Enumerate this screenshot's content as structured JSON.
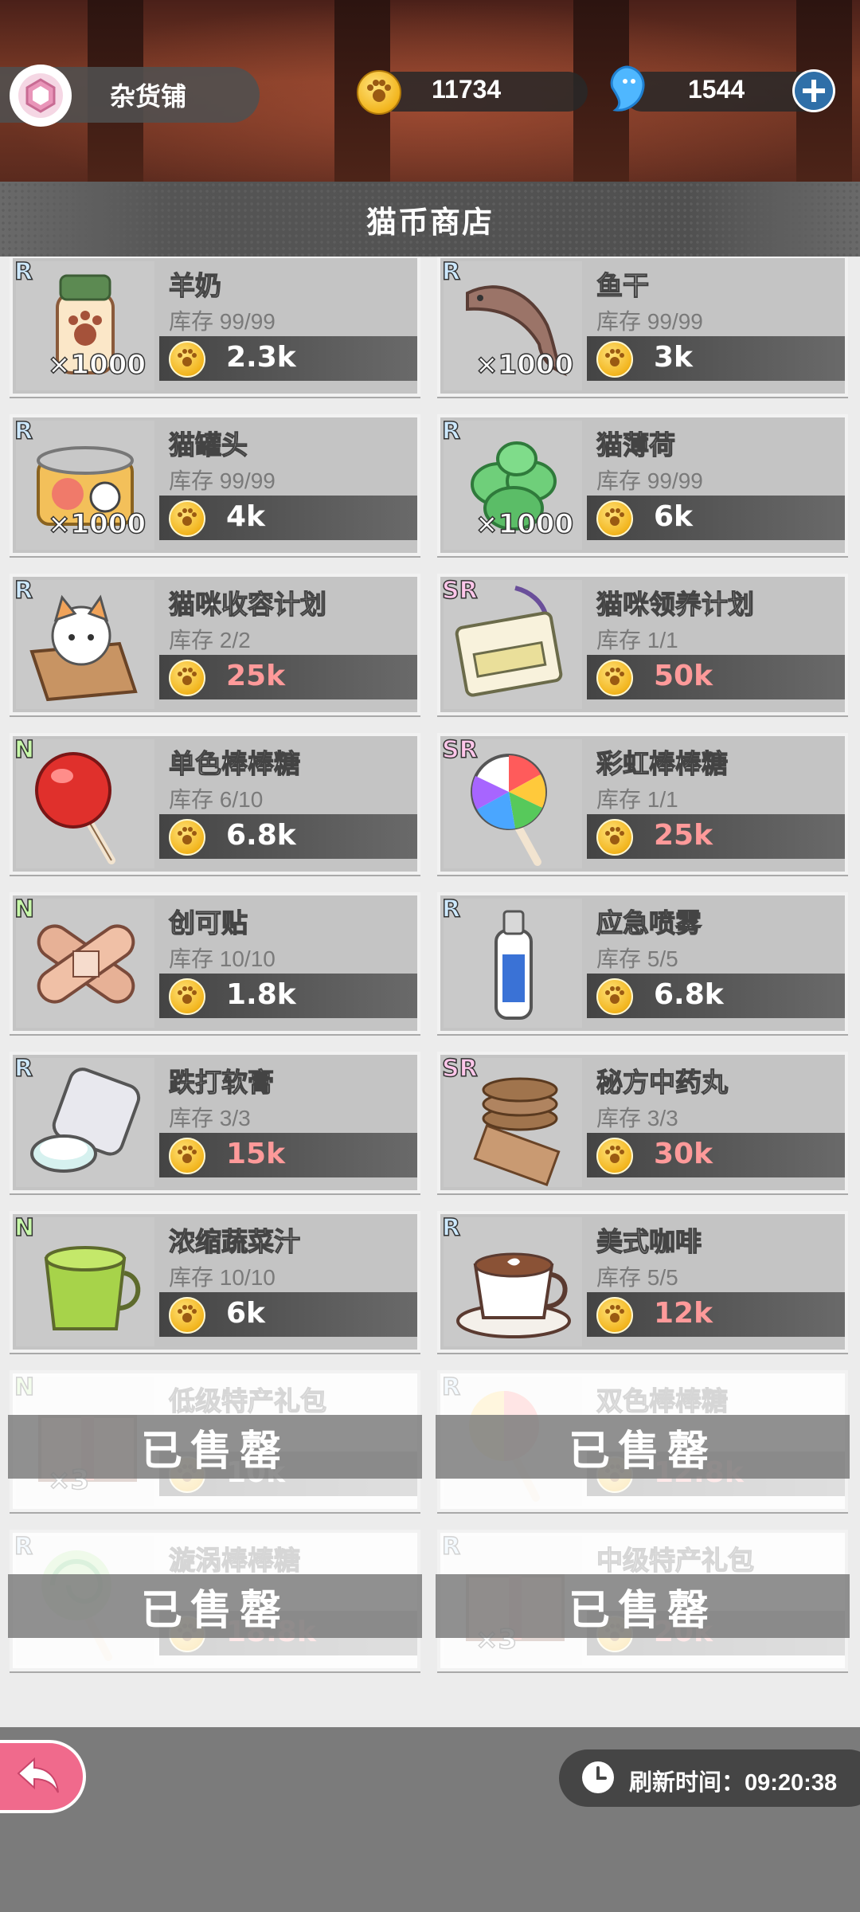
{
  "header": {
    "shop_name": "杂货铺",
    "coins": "11734",
    "gems": "1544"
  },
  "title": "猫币商店",
  "items": [
    {
      "name": "羊奶",
      "rarity": "R",
      "stock": "库存 99/99",
      "price": "2.3k",
      "qty": "×1000",
      "expensive": false,
      "sold_out": false,
      "icon": "goat-milk-icon"
    },
    {
      "name": "鱼干",
      "rarity": "R",
      "stock": "库存 99/99",
      "price": "3k",
      "qty": "×1000",
      "expensive": false,
      "sold_out": false,
      "icon": "dried-fish-icon"
    },
    {
      "name": "猫罐头",
      "rarity": "R",
      "stock": "库存 99/99",
      "price": "4k",
      "qty": "×1000",
      "expensive": false,
      "sold_out": false,
      "icon": "cat-can-icon"
    },
    {
      "name": "猫薄荷",
      "rarity": "R",
      "stock": "库存 99/99",
      "price": "6k",
      "qty": "×1000",
      "expensive": false,
      "sold_out": false,
      "icon": "catnip-icon"
    },
    {
      "name": "猫咪收容计划",
      "rarity": "R",
      "stock": "库存 2/2",
      "price": "25k",
      "qty": "",
      "expensive": true,
      "sold_out": false,
      "icon": "cat-box-icon"
    },
    {
      "name": "猫咪领养计划",
      "rarity": "SR",
      "stock": "库存 1/1",
      "price": "50k",
      "qty": "",
      "expensive": true,
      "sold_out": false,
      "icon": "adoption-card-icon"
    },
    {
      "name": "单色棒棒糖",
      "rarity": "N",
      "stock": "库存 6/10",
      "price": "6.8k",
      "qty": "",
      "expensive": false,
      "sold_out": false,
      "icon": "red-lollipop-icon"
    },
    {
      "name": "彩虹棒棒糖",
      "rarity": "SR",
      "stock": "库存 1/1",
      "price": "25k",
      "qty": "",
      "expensive": true,
      "sold_out": false,
      "icon": "rainbow-lollipop-icon"
    },
    {
      "name": "创可贴",
      "rarity": "N",
      "stock": "库存 10/10",
      "price": "1.8k",
      "qty": "",
      "expensive": false,
      "sold_out": false,
      "icon": "bandage-icon"
    },
    {
      "name": "应急喷雾",
      "rarity": "R",
      "stock": "库存 5/5",
      "price": "6.8k",
      "qty": "",
      "expensive": false,
      "sold_out": false,
      "icon": "spray-bottle-icon"
    },
    {
      "name": "跌打软膏",
      "rarity": "R",
      "stock": "库存 3/3",
      "price": "15k",
      "qty": "",
      "expensive": true,
      "sold_out": false,
      "icon": "ointment-icon"
    },
    {
      "name": "秘方中药丸",
      "rarity": "SR",
      "stock": "库存 3/3",
      "price": "30k",
      "qty": "",
      "expensive": true,
      "sold_out": false,
      "icon": "herbal-pills-icon"
    },
    {
      "name": "浓缩蔬菜汁",
      "rarity": "N",
      "stock": "库存 10/10",
      "price": "6k",
      "qty": "",
      "expensive": false,
      "sold_out": false,
      "icon": "veggie-juice-icon"
    },
    {
      "name": "美式咖啡",
      "rarity": "R",
      "stock": "库存 5/5",
      "price": "12k",
      "qty": "",
      "expensive": true,
      "sold_out": false,
      "icon": "coffee-icon"
    },
    {
      "name": "低级特产礼包",
      "rarity": "N",
      "stock": "",
      "price": "10k",
      "qty": "×3",
      "expensive": false,
      "sold_out": true,
      "icon": "gift-box-icon"
    },
    {
      "name": "双色棒棒糖",
      "rarity": "R",
      "stock": "",
      "price": "12.8k",
      "qty": "",
      "expensive": true,
      "sold_out": true,
      "icon": "twin-lollipop-icon"
    },
    {
      "name": "漩涡棒棒糖",
      "rarity": "R",
      "stock": "",
      "price": "18.8k",
      "qty": "",
      "expensive": true,
      "sold_out": true,
      "icon": "swirl-lollipop-icon"
    },
    {
      "name": "中级特产礼包",
      "rarity": "R",
      "stock": "",
      "price": "20k",
      "qty": "×3",
      "expensive": true,
      "sold_out": true,
      "icon": "gift-box-icon"
    }
  ],
  "sold_out_label": "已售罄",
  "footer": {
    "refresh_label": "刷新时间：09:20:38"
  }
}
